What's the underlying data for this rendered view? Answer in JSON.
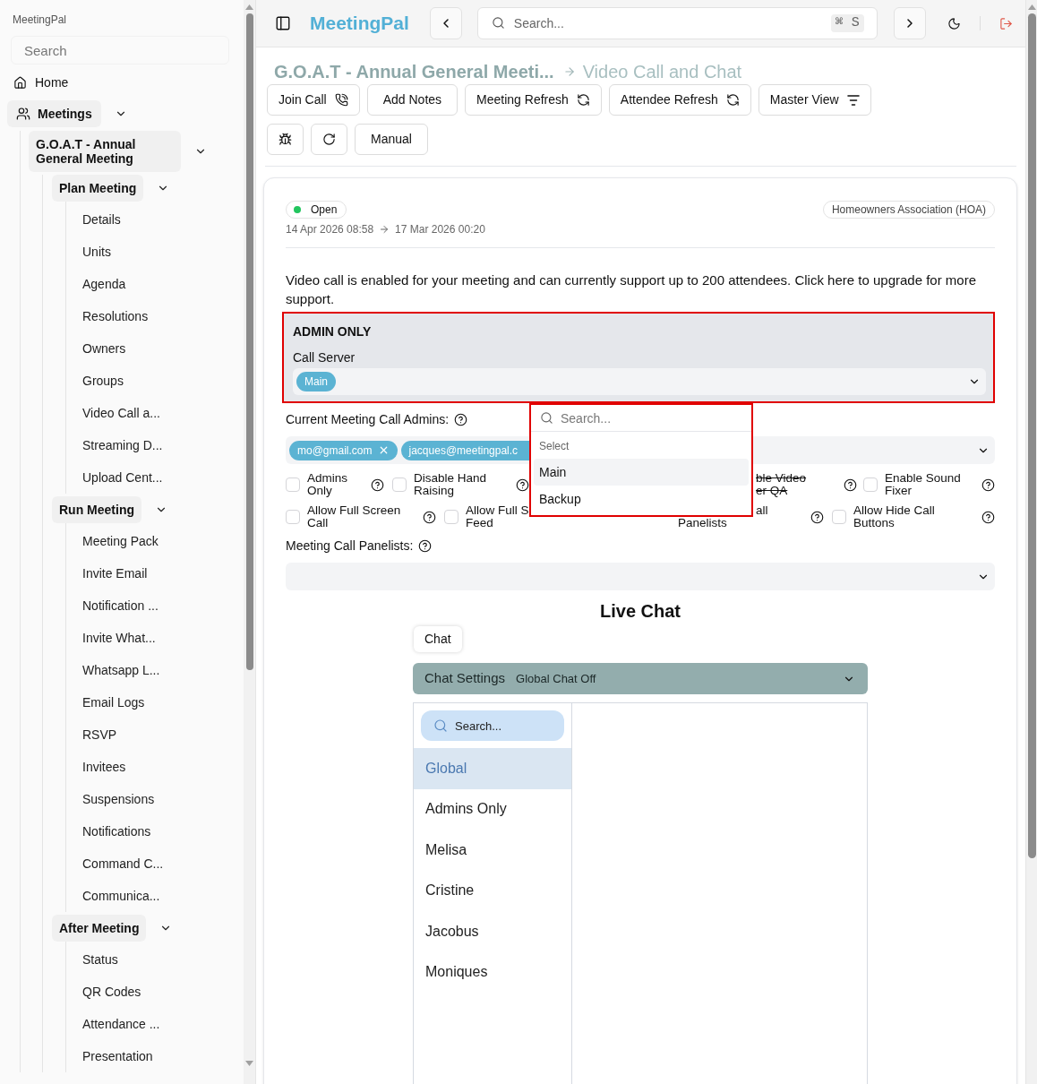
{
  "sidebar": {
    "app_name": "MeetingPal",
    "search": {
      "placeholder": "Search"
    },
    "nav": [
      {
        "kind": "link",
        "label": "Home"
      },
      {
        "kind": "group",
        "label": "Meetings",
        "expanded": true,
        "children": [
          {
            "kind": "group",
            "label": "G.O.A.T - Annual General Meeting",
            "expanded": true,
            "children": [
              {
                "kind": "group",
                "label": "Plan Meeting",
                "expanded": true,
                "children": [
                  {
                    "kind": "link",
                    "label": "Details"
                  },
                  {
                    "kind": "link",
                    "label": "Units"
                  },
                  {
                    "kind": "link",
                    "label": "Agenda"
                  },
                  {
                    "kind": "link",
                    "label": "Resolutions"
                  },
                  {
                    "kind": "link",
                    "label": "Owners"
                  },
                  {
                    "kind": "link",
                    "label": "Groups"
                  },
                  {
                    "kind": "link",
                    "label": "Video Call a..."
                  },
                  {
                    "kind": "link",
                    "label": "Streaming D..."
                  },
                  {
                    "kind": "link",
                    "label": "Upload Cent..."
                  }
                ]
              },
              {
                "kind": "group",
                "label": "Run Meeting",
                "expanded": true,
                "children": [
                  {
                    "kind": "link",
                    "label": "Meeting Pack"
                  },
                  {
                    "kind": "link",
                    "label": "Invite Email"
                  },
                  {
                    "kind": "link",
                    "label": "Notification ..."
                  },
                  {
                    "kind": "link",
                    "label": "Invite What..."
                  },
                  {
                    "kind": "link",
                    "label": "Whatsapp L..."
                  },
                  {
                    "kind": "link",
                    "label": "Email Logs"
                  },
                  {
                    "kind": "link",
                    "label": "RSVP"
                  },
                  {
                    "kind": "link",
                    "label": "Invitees"
                  },
                  {
                    "kind": "link",
                    "label": "Suspensions"
                  },
                  {
                    "kind": "link",
                    "label": "Notifications"
                  },
                  {
                    "kind": "link",
                    "label": "Command C..."
                  },
                  {
                    "kind": "link",
                    "label": "Communica..."
                  }
                ]
              },
              {
                "kind": "group",
                "label": "After Meeting",
                "expanded": true,
                "children": [
                  {
                    "kind": "link",
                    "label": "Status"
                  },
                  {
                    "kind": "link",
                    "label": "QR Codes"
                  },
                  {
                    "kind": "link",
                    "label": "Attendance ..."
                  },
                  {
                    "kind": "link",
                    "label": "Presentation"
                  }
                ]
              }
            ]
          }
        ]
      }
    ]
  },
  "header": {
    "brand": "MeetingPal",
    "search": {
      "placeholder": "Search...",
      "shortcut": "⌘ S"
    }
  },
  "breadcrumb": {
    "parent": "G.O.A.T - Annual General Meeti...",
    "current": "Video Call and Chat"
  },
  "toolbar": [
    [
      {
        "kind": "text",
        "label": "Join Call"
      },
      {
        "kind": "text",
        "label": "Add Notes"
      },
      {
        "kind": "text",
        "label": "Meeting Refresh"
      },
      {
        "kind": "text",
        "label": "Attendee Refresh"
      },
      {
        "kind": "text",
        "label": "Master View"
      }
    ],
    [
      {
        "kind": "icon"
      },
      {
        "kind": "icon"
      },
      {
        "kind": "text",
        "label": "Manual"
      }
    ]
  ],
  "meeting": {
    "status": "Open",
    "association": "Homeowners Association (HOA)",
    "start": "14 Apr 2026 08:58",
    "end": "17 Mar 2026 00:20"
  },
  "video_call": {
    "notice": "Video call is enabled for your meeting and can currently support up to 200 attendees. Click here to upgrade for more support.",
    "admin_section": {
      "title": "ADMIN ONLY",
      "highlighted": true,
      "field_label": "Call Server",
      "value": "Main"
    },
    "call_admins": {
      "label": "Current Meeting Call Admins:",
      "tags": [
        {
          "label": "mo@gmail.com",
          "removable": true
        },
        {
          "label": "jacques@meetingpal.c",
          "removable": false
        }
      ]
    },
    "options": [
      {
        "kind": "checkbox",
        "lines": [
          "Admins",
          "Only"
        ],
        "checked": false,
        "struck": false,
        "help": true
      },
      {
        "kind": "checkbox",
        "lines": [
          "Disable Hand",
          "Raising"
        ],
        "checked": false,
        "struck": false,
        "help": true
      },
      {
        "kind": "fragment",
        "lines": [
          "ble Video",
          "er QA"
        ],
        "struck": true,
        "help": true
      },
      {
        "kind": "checkbox",
        "lines": [
          "Enable Sound",
          "Fixer"
        ],
        "checked": false,
        "struck": false,
        "help": true
      },
      {
        "kind": "checkbox",
        "lines": [
          "Allow Full Screen",
          "Call"
        ],
        "checked": false,
        "struck": false,
        "help": true
      },
      {
        "kind": "checkbox",
        "lines": [
          "Allow Full S",
          "Feed"
        ],
        "checked": false,
        "struck": false,
        "help": false
      },
      {
        "kind": "fragment",
        "lines": [
          "all",
          "Panelists"
        ],
        "struck": false,
        "help": true
      },
      {
        "kind": "checkbox",
        "lines": [
          "Allow Hide Call",
          "Buttons"
        ],
        "checked": false,
        "struck": false,
        "help": true
      }
    ],
    "panelists": {
      "label": "Meeting Call Panelists:"
    }
  },
  "call_server_menu": {
    "highlighted": true,
    "search": {
      "placeholder": "Search..."
    },
    "heading": "Select",
    "options": [
      {
        "label": "Main",
        "selected": true
      },
      {
        "label": "Backup",
        "selected": false
      }
    ]
  },
  "live_chat": {
    "title": "Live Chat",
    "tabs": [
      {
        "label": "Chat",
        "selected": true
      }
    ],
    "settings": {
      "title": "Chat Settings",
      "status": "Global Chat Off"
    },
    "search": {
      "placeholder": "Search..."
    },
    "conversations": [
      {
        "label": "Global",
        "selected": true
      },
      {
        "label": "Admins Only",
        "selected": false
      },
      {
        "label": "Melisa",
        "selected": false
      },
      {
        "label": "Cristine",
        "selected": false
      },
      {
        "label": "Jacobus",
        "selected": false
      },
      {
        "label": "Moniques",
        "selected": false
      }
    ]
  }
}
